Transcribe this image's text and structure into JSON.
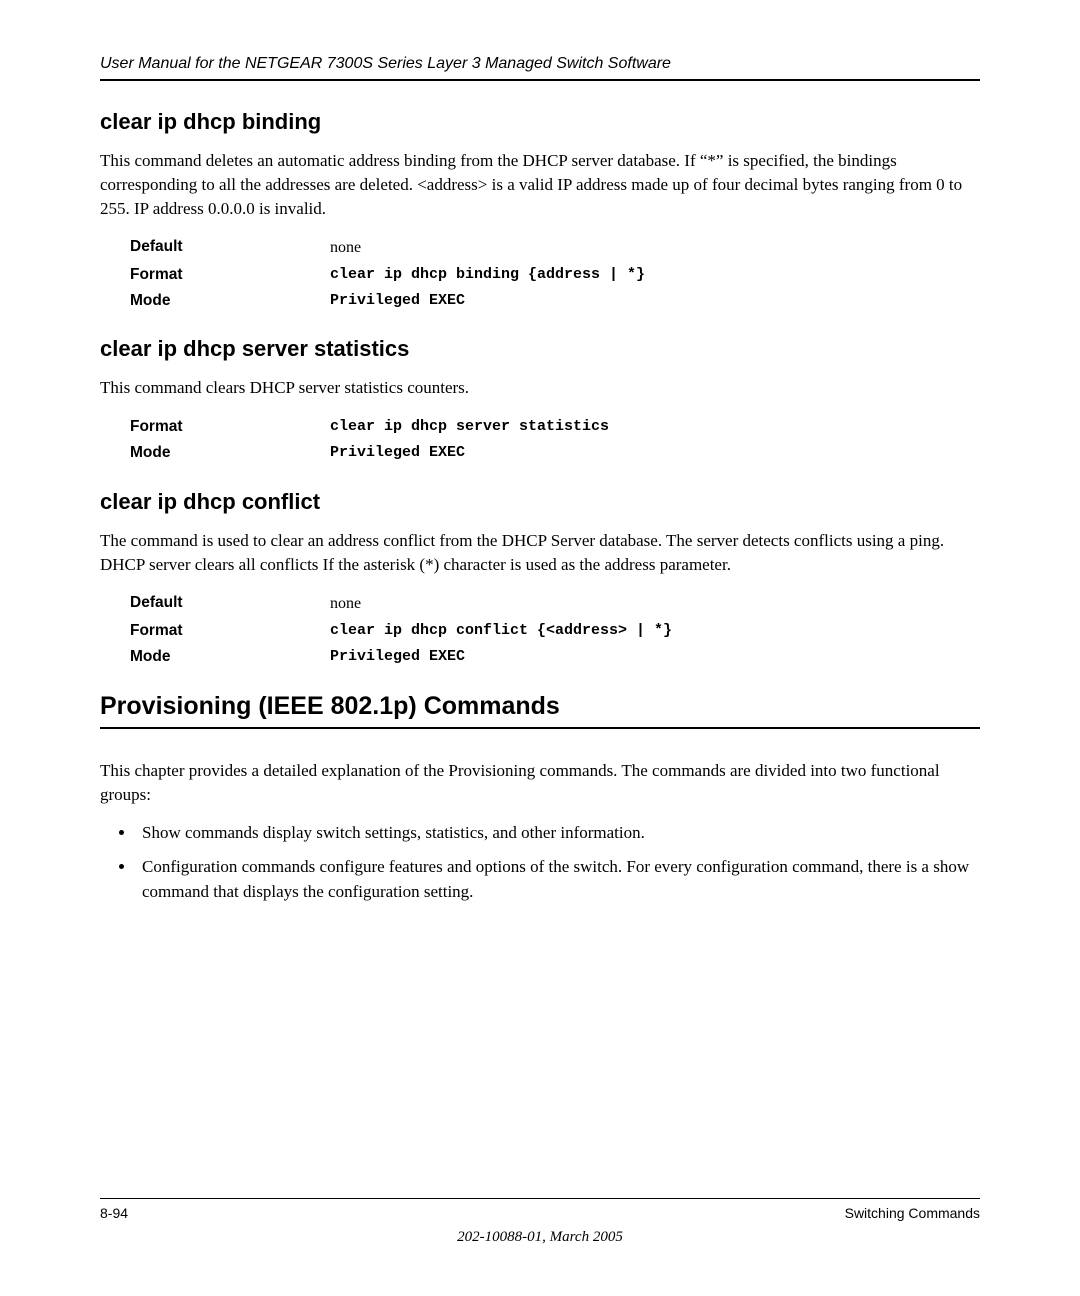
{
  "header": {
    "running_head": "User Manual for the NETGEAR 7300S Series Layer 3 Managed Switch Software"
  },
  "sections": {
    "cmd1": {
      "title": "clear ip dhcp binding",
      "desc": "This command deletes an automatic address binding from the DHCP server database. If “*” is specified, the bindings corresponding to all the addresses are deleted. <address> is a valid IP address made up of four decimal bytes ranging from 0 to 255. IP address 0.0.0.0 is invalid.",
      "params": {
        "default_label": "Default",
        "default_value": "none",
        "format_label": "Format",
        "format_value": "clear ip dhcp binding {address | *}",
        "mode_label": "Mode",
        "mode_value": "Privileged EXEC"
      }
    },
    "cmd2": {
      "title": "clear ip dhcp server statistics",
      "desc": "This command clears DHCP server statistics counters.",
      "params": {
        "format_label": "Format",
        "format_value": "clear ip dhcp server statistics",
        "mode_label": "Mode",
        "mode_value": "Privileged EXEC"
      }
    },
    "cmd3": {
      "title": "clear ip dhcp conflict",
      "desc": "The command is used to clear an address conflict from the DHCP Server database. The server detects conflicts using a ping. DHCP server clears all conflicts If the asterisk (*) character is used as the address parameter.",
      "params": {
        "default_label": "Default",
        "default_value": "none",
        "format_label": "Format",
        "format_value": "clear ip dhcp conflict {<address> | *}",
        "mode_label": "Mode",
        "mode_value": "Privileged EXEC"
      }
    },
    "provisioning": {
      "title": "Provisioning (IEEE 802.1p) Commands",
      "intro": "This chapter provides a detailed explanation of the Provisioning commands. The commands are divided into two functional groups:",
      "bullets": [
        "Show commands display switch settings, statistics, and other information.",
        "Configuration commands configure features and options of the switch. For every configuration command, there is a show command that displays the configuration setting."
      ]
    }
  },
  "footer": {
    "page_num": "8-94",
    "section_name": "Switching Commands",
    "doc_num": "202-10088-01, March 2005"
  }
}
